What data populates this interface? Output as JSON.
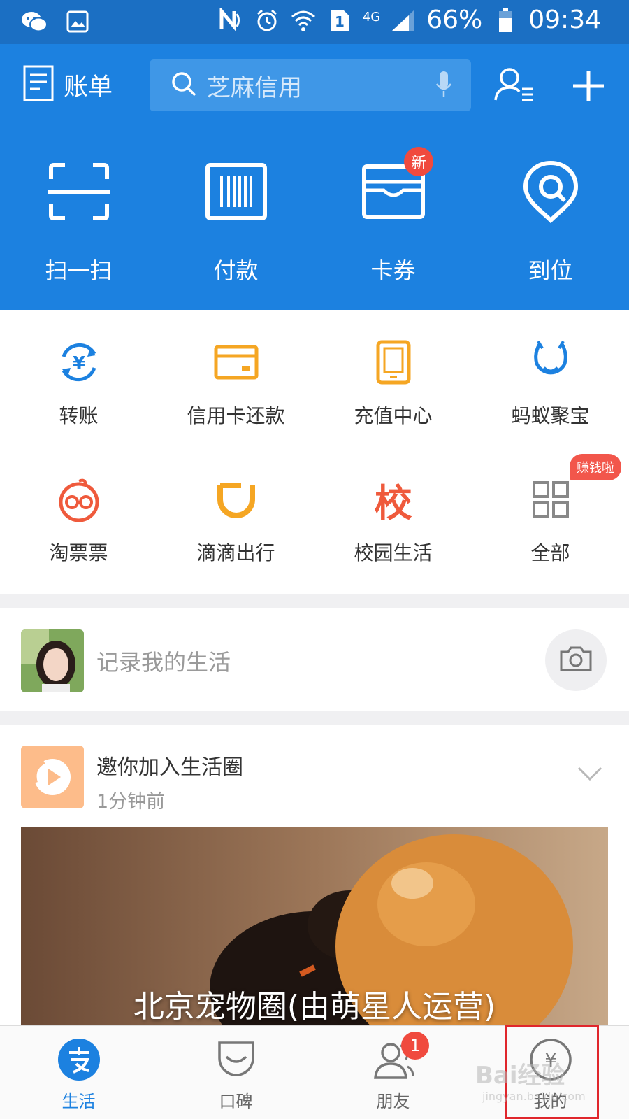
{
  "status_bar": {
    "battery": "66%",
    "time": "09:34",
    "network": "4G",
    "sim": "1",
    "left_icons": [
      "wechat-icon",
      "gallery-icon"
    ],
    "right_icons": [
      "nfc-icon",
      "alarm-icon",
      "wifi-icon",
      "sim-icon",
      "signal-icon",
      "battery-icon"
    ]
  },
  "header": {
    "bill_label": "账单",
    "search_placeholder": "芝麻信用",
    "icons": [
      "bill-icon",
      "search-icon",
      "mic-icon",
      "contacts-icon",
      "plus-icon"
    ],
    "bg_color": "#1c81e0"
  },
  "quick_actions": [
    {
      "label": "扫一扫",
      "icon": "scan-icon"
    },
    {
      "label": "付款",
      "icon": "barcode-icon"
    },
    {
      "label": "卡券",
      "icon": "card-wallet-icon",
      "badge": "新"
    },
    {
      "label": "到位",
      "icon": "location-pin-icon"
    }
  ],
  "services": {
    "row1": [
      {
        "label": "转账",
        "icon": "transfer-icon",
        "color": "#1c81e0"
      },
      {
        "label": "信用卡还款",
        "icon": "credit-card-icon",
        "color": "#f5a623"
      },
      {
        "label": "充值中心",
        "icon": "phone-recharge-icon",
        "color": "#f5a623"
      },
      {
        "label": "蚂蚁聚宝",
        "icon": "ant-fortune-icon",
        "color": "#1c81e0"
      }
    ],
    "row2": [
      {
        "label": "淘票票",
        "icon": "taopiaopiao-icon",
        "color": "#ef5a3c"
      },
      {
        "label": "滴滴出行",
        "icon": "didi-icon",
        "color": "#f5a623"
      },
      {
        "label": "校园生活",
        "icon": "campus-icon",
        "glyph": "校",
        "color": "#ef5a3c"
      },
      {
        "label": "全部",
        "icon": "grid-all-icon",
        "badge": "赚钱啦",
        "color": "#888888"
      }
    ]
  },
  "post_box": {
    "placeholder": "记录我的生活",
    "icons": [
      "avatar",
      "camera-icon"
    ]
  },
  "feed": {
    "title": "邀你加入生活圈",
    "time": "1分钟前",
    "caption": "北京宠物圈(由萌星人运营)",
    "icons": [
      "video-play-icon",
      "chevron-down-icon"
    ]
  },
  "tab_bar": [
    {
      "label": "生活",
      "icon": "alipay-icon",
      "active": true
    },
    {
      "label": "口碑",
      "icon": "koubei-icon"
    },
    {
      "label": "朋友",
      "icon": "friends-icon",
      "badge": "1"
    },
    {
      "label": "我的",
      "icon": "wallet-yuan-icon"
    }
  ],
  "watermark": {
    "text": "Bai经验",
    "sub": "jingyan.baidu.com"
  }
}
